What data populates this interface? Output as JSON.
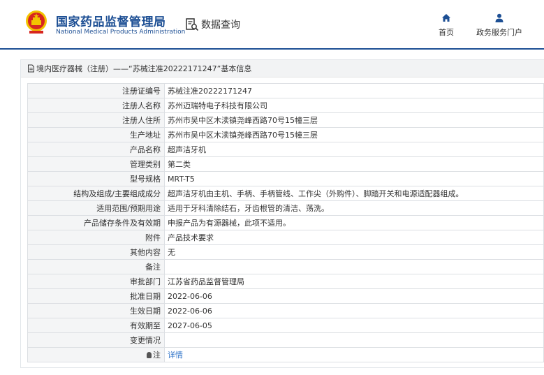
{
  "brand": {
    "title_cn": "国家药品监督管理局",
    "title_en": "National Medical Products Administration"
  },
  "header": {
    "data_query_label": "数据查询"
  },
  "nav": {
    "home_label": "首页",
    "portal_label": "政务服务门户"
  },
  "colors": {
    "brand": "#1d4f94",
    "link": "#2e73c8",
    "logo_red": "#d7261f",
    "logo_gold": "#f2c300"
  },
  "panel": {
    "title": "境内医疗器械（注册）——“苏械注准20222171247”基本信息"
  },
  "fields": [
    {
      "label": "注册证编号",
      "value": "苏械注准20222171247"
    },
    {
      "label": "注册人名称",
      "value": "苏州迈瑞特电子科技有限公司"
    },
    {
      "label": "注册人住所",
      "value": "苏州市吴中区木渎镇尧峰西路70号15幢三层"
    },
    {
      "label": "生产地址",
      "value": "苏州市吴中区木渎镇尧峰西路70号15幢三层"
    },
    {
      "label": "产品名称",
      "value": "超声洁牙机"
    },
    {
      "label": "管理类别",
      "value": "第二类"
    },
    {
      "label": "型号规格",
      "value": "MRT-T5"
    },
    {
      "label": "结构及组成/主要组成成分",
      "value": "超声洁牙机由主机、手柄、手柄管线、工作尖（外购件）、脚踏开关和电源适配器组成。"
    },
    {
      "label": "适用范围/预期用途",
      "value": "适用于牙科清除结石，牙齿根管的清洁、荡洗。"
    },
    {
      "label": "产品储存条件及有效期",
      "value": "申报产品为有源器械，此项不适用。"
    },
    {
      "label": "附件",
      "value": "产品技术要求"
    },
    {
      "label": "其他内容",
      "value": "无"
    },
    {
      "label": "备注",
      "value": ""
    },
    {
      "label": "审批部门",
      "value": "江苏省药品监督管理局"
    },
    {
      "label": "批准日期",
      "value": "2022-06-06"
    },
    {
      "label": "生效日期",
      "value": "2022-06-06"
    },
    {
      "label": "有效期至",
      "value": "2027-06-05"
    },
    {
      "label": "变更情况",
      "value": ""
    }
  ],
  "note": {
    "label": "注",
    "link": "详情"
  }
}
